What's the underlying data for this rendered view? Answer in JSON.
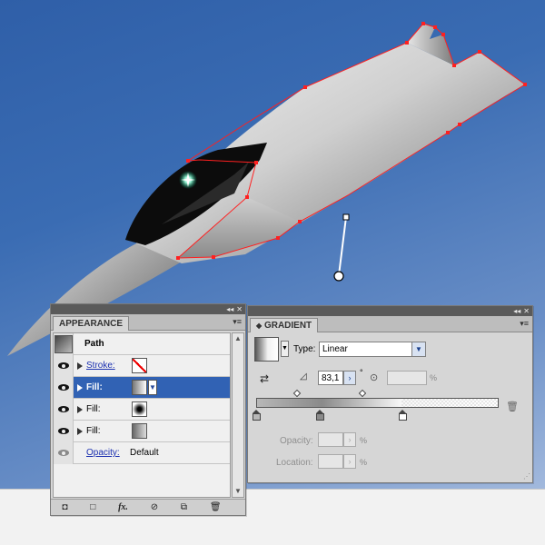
{
  "appearance": {
    "tab_label": "APPEARANCE",
    "path_label": "Path",
    "rows": [
      {
        "label": "Stroke:",
        "swatch": "none"
      },
      {
        "label": "Fill:",
        "swatch": "gradient-linear"
      },
      {
        "label": "Fill:",
        "swatch": "gradient-radial"
      },
      {
        "label": "Fill:",
        "swatch": "gradient-grey"
      }
    ],
    "opacity_label": "Opacity:",
    "opacity_value": "Default",
    "footer_icons": [
      "add-layer-icon",
      "clear-icon",
      "fx-icon",
      "no-icon",
      "duplicate-icon",
      "trash-icon"
    ]
  },
  "gradient": {
    "tab_label": "GRADIENT",
    "type_label": "Type:",
    "type_value": "Linear",
    "angle_value": "83,1",
    "degree_symbol": "°",
    "aspect_unit": "%",
    "opacity_label": "Opacity:",
    "opacity_unit": "%",
    "location_label": "Location:",
    "location_unit": "%"
  },
  "colors": {
    "selection": "#3162b4",
    "canvas_top": "#2f5fa8",
    "path_anchor": "#ff0000"
  }
}
